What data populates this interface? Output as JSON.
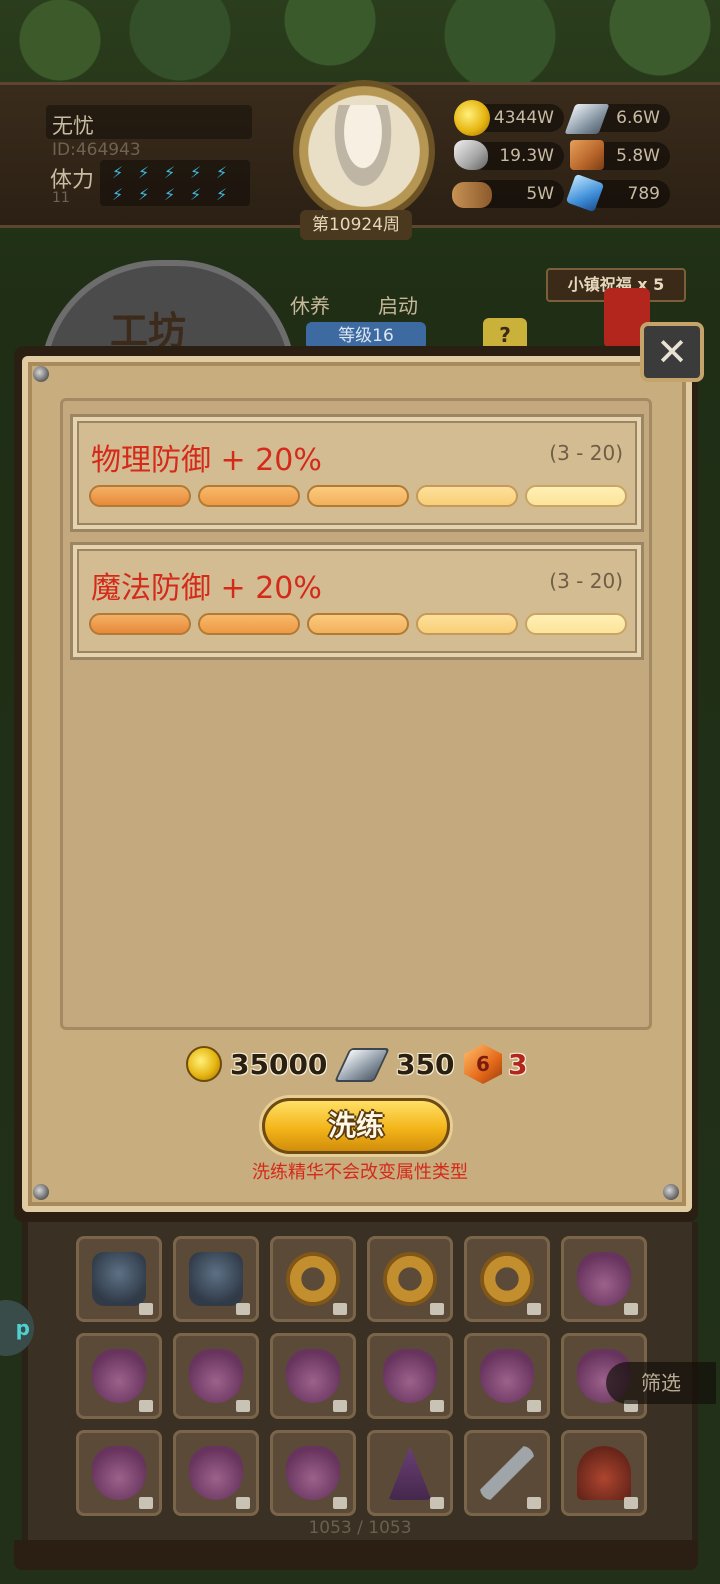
{
  "header": {
    "player_name": "无忧",
    "player_id": "ID:464943",
    "stamina_label": "体力",
    "stamina_value": "11",
    "week_label": "第10924周"
  },
  "resources": [
    {
      "icon": "gold-coin-icon",
      "value": "4344W"
    },
    {
      "icon": "steel-ingot-icon",
      "value": "6.6W"
    },
    {
      "icon": "ore-icon",
      "value": "19.3W"
    },
    {
      "icon": "leather-icon",
      "value": "5.8W"
    },
    {
      "icon": "wood-log-icon",
      "value": "5W"
    },
    {
      "icon": "crystal-icon",
      "value": "789"
    }
  ],
  "scene": {
    "town_blessing": "小镇祝福 x 5",
    "workshop_title": "工坊",
    "rest_label": "休养",
    "start_label": "启动",
    "level_label": "等级16",
    "help_label": "?"
  },
  "refine_panel": {
    "attributes": [
      {
        "name": "物理防御 + 20%",
        "range": "(3 - 20)",
        "segments": 5
      },
      {
        "name": "魔法防御 + 20%",
        "range": "(3 - 20)",
        "segments": 5
      }
    ],
    "costs": [
      {
        "icon": "gold-coin-icon",
        "value": "35000"
      },
      {
        "icon": "steel-ingot-icon",
        "value": "350"
      },
      {
        "icon": "refine-gem-icon",
        "gem_glyph": "6",
        "value": "3"
      }
    ],
    "refine_button": "洗练",
    "hint": "洗练精华不会改变属性类型"
  },
  "inventory": {
    "filter_label": "筛选",
    "count": "1053 / 1053",
    "side_bubble": "p",
    "rows": [
      [
        "armor",
        "armor",
        "ring",
        "ring",
        "ring",
        "bag"
      ],
      [
        "bag",
        "bag",
        "bag",
        "bag",
        "bag",
        "bag"
      ],
      [
        "bag",
        "bag",
        "bag",
        "hat",
        "sword",
        "helm"
      ]
    ]
  },
  "colors": {
    "attribute_text": "#d42a1a",
    "panel_bg": "#c8ad7f",
    "button_gold": "#f3b51a"
  }
}
